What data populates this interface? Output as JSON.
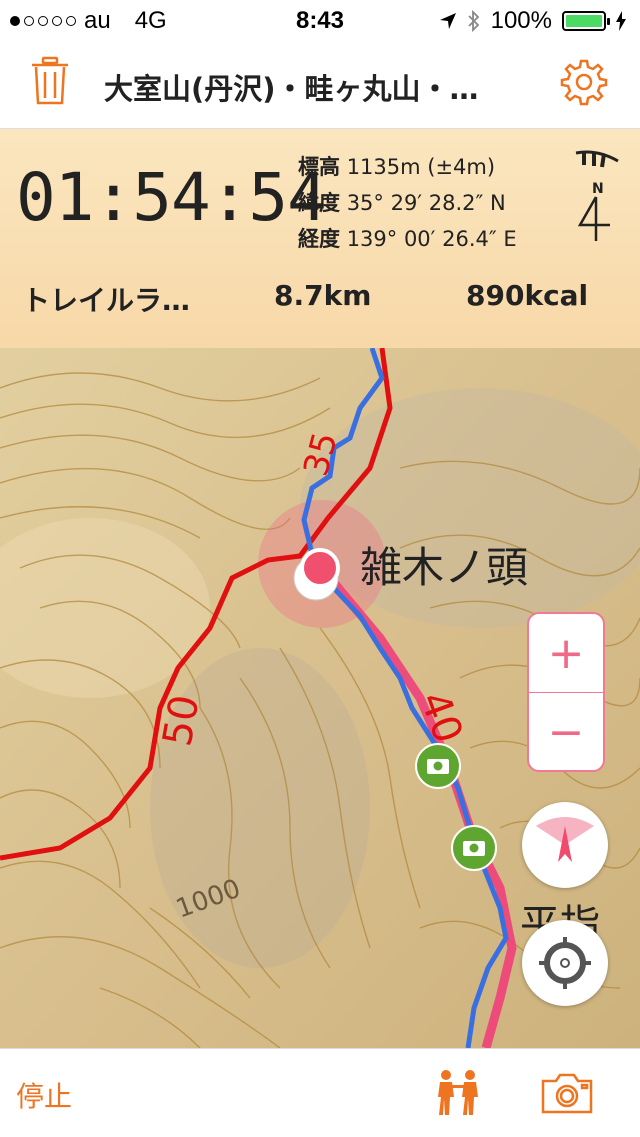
{
  "status_bar": {
    "carrier": "au",
    "network": "4G",
    "time": "8:43",
    "battery": "100%",
    "icons": [
      "location-arrow-icon",
      "bluetooth-icon",
      "battery-icon",
      "charging-icon"
    ]
  },
  "nav": {
    "title": "大室山(丹沢)・畦ヶ丸山・…",
    "left_icon": "trash-icon",
    "right_icon": "gear-icon"
  },
  "info": {
    "elapsed_time": "01:54:54",
    "elevation_label": "標高",
    "elevation_value": "1135m (±4m)",
    "latitude_label": "緯度",
    "latitude_value": "35° 29′ 28.2″ N",
    "longitude_label": "経度",
    "longitude_value": "139° 00′ 26.4″ E",
    "compass_label": "N",
    "activity": "トレイルラ…",
    "distance": "8.7km",
    "calories": "890kcal"
  },
  "map": {
    "peak_label": "雑木ノ頭",
    "peak_label_2": "平指",
    "contour_label_1": "1000",
    "route_label_1": "35",
    "route_label_2": "50",
    "route_label_3": "40",
    "zoom_in": "+",
    "zoom_out": "−",
    "colors": {
      "track": "#3a6fe0",
      "route": "#f0407a",
      "trail": "#e01010",
      "accent": "#f06a88"
    }
  },
  "toolbar": {
    "stop_label": "停止",
    "accent_color": "#ee7420"
  }
}
